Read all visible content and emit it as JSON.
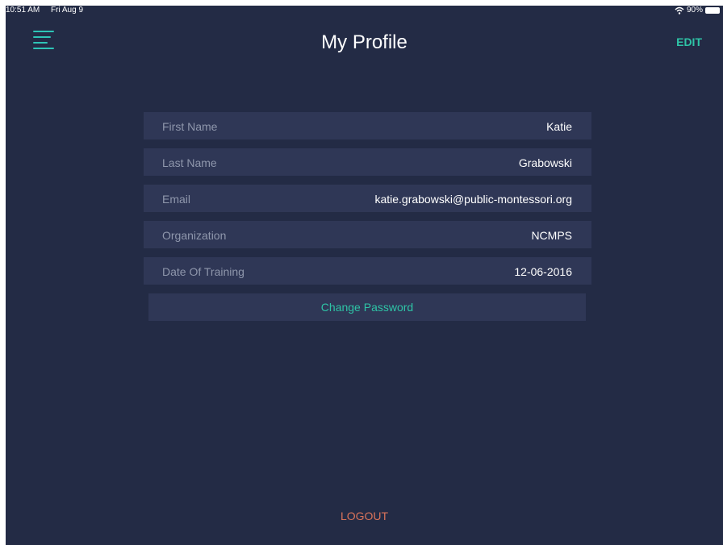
{
  "status_bar": {
    "time": "10:51 AM",
    "date": "Fri Aug 9",
    "battery": "90%"
  },
  "header": {
    "title": "My Profile",
    "edit_label": "EDIT"
  },
  "profile": {
    "fields": [
      {
        "label": "First Name",
        "value": "Katie"
      },
      {
        "label": "Last Name",
        "value": "Grabowski"
      },
      {
        "label": "Email",
        "value": "katie.grabowski@public-montessori.org"
      },
      {
        "label": "Organization",
        "value": "NCMPS"
      },
      {
        "label": "Date Of Training",
        "value": "12-06-2016"
      }
    ],
    "change_password_label": "Change Password"
  },
  "footer": {
    "logout_label": "LOGOUT"
  },
  "colors": {
    "background": "#232b45",
    "row": "#2f3756",
    "accent": "#2ec4a6",
    "logout": "#d9735a"
  }
}
